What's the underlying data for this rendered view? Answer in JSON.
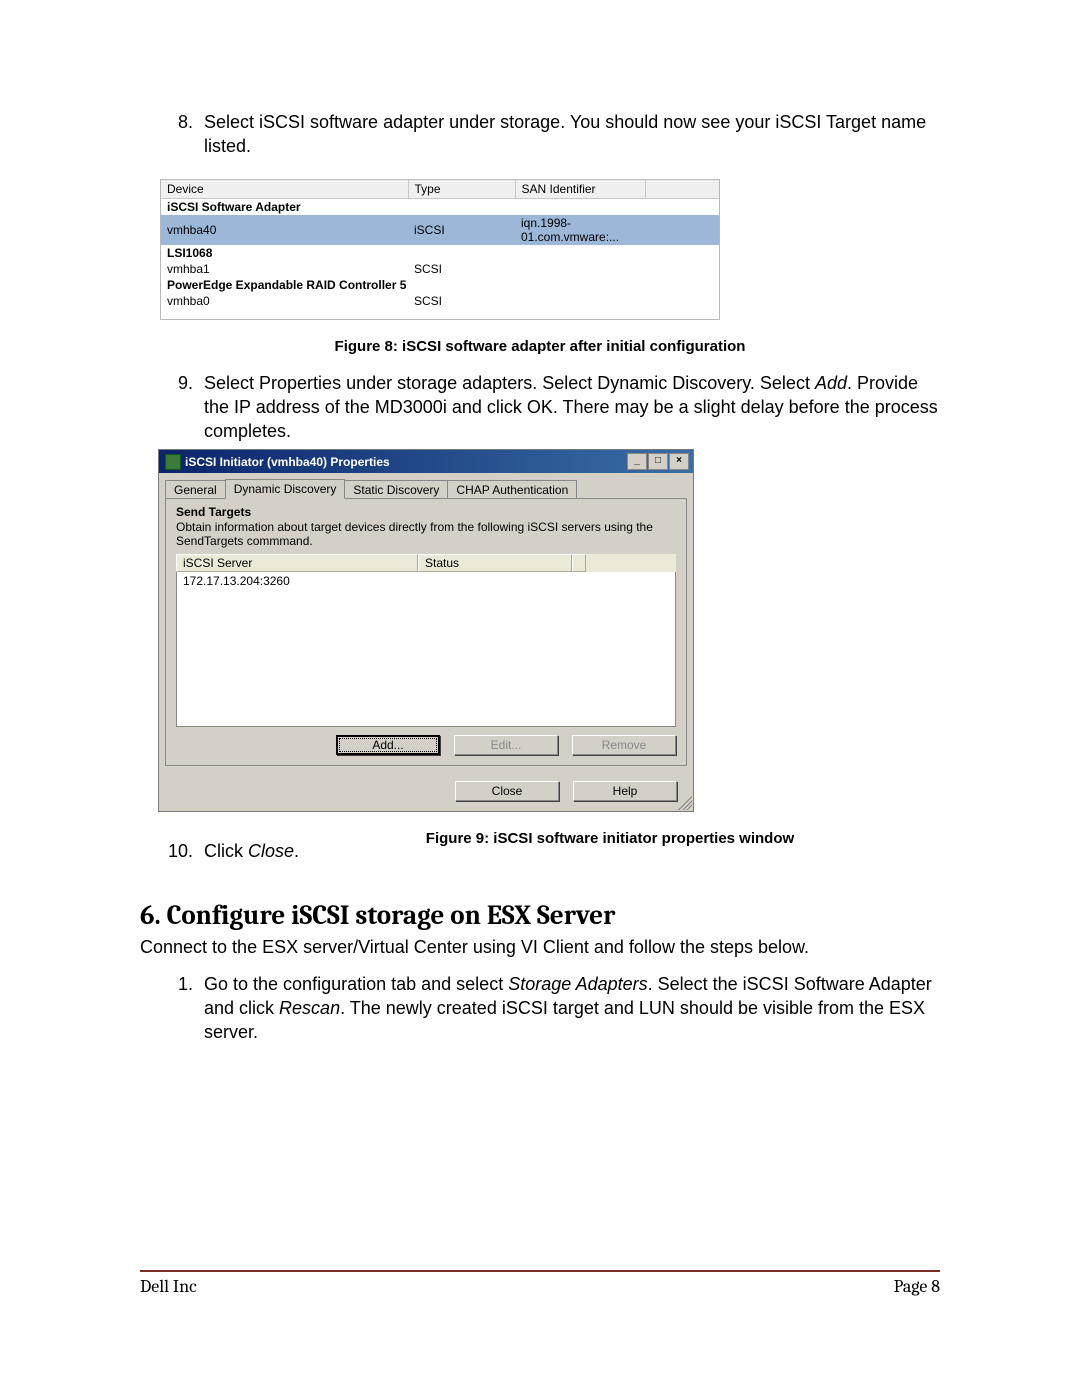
{
  "steps": {
    "step8": "Select iSCSI software adapter under storage. You should now see your iSCSI Target name listed.",
    "step9_a": "Select Properties under storage adapters. Select Dynamic Discovery. Select ",
    "step9_add": "Add",
    "step9_b": ". Provide the IP address of the MD3000i and click OK.  There may be a slight delay before the process completes.",
    "step10_a": "Click ",
    "step10_close": "Close",
    "step10_b": "."
  },
  "figure8": {
    "headers": {
      "device": "Device",
      "type": "Type",
      "san": "SAN Identifier"
    },
    "groups": [
      {
        "name": "iSCSI Software Adapter",
        "rows": [
          {
            "device": "vmhba40",
            "type": "iSCSI",
            "san": "iqn.1998-01.com.vmware:...",
            "selected": true
          }
        ]
      },
      {
        "name": "LSI1068",
        "rows": [
          {
            "device": "vmhba1",
            "type": "SCSI",
            "san": ""
          }
        ]
      },
      {
        "name": "PowerEdge Expandable RAID Controller 5",
        "rows": [
          {
            "device": "vmhba0",
            "type": "SCSI",
            "san": ""
          }
        ]
      }
    ],
    "caption": "Figure 8: iSCSI software adapter after initial configuration"
  },
  "dialog": {
    "title": "iSCSI Initiator (vmhba40) Properties",
    "tabs": [
      "General",
      "Dynamic Discovery",
      "Static Discovery",
      "CHAP Authentication"
    ],
    "active_tab": 1,
    "send_targets_title": "Send Targets",
    "send_targets_desc": "Obtain information about target devices directly from the following iSCSI servers using the SendTargets commmand.",
    "columns": {
      "server": "iSCSI Server",
      "status": "Status"
    },
    "rows": [
      {
        "server": "172.17.13.204:3260",
        "status": ""
      }
    ],
    "buttons": {
      "add": "Add...",
      "edit": "Edit...",
      "remove": "Remove",
      "close": "Close",
      "help": "Help"
    },
    "winbtn": {
      "min": "_",
      "max": "□",
      "close": "×"
    },
    "caption": "Figure 9: iSCSI software initiator properties window"
  },
  "section6": {
    "title": "6. Configure iSCSI storage on ESX Server",
    "intro": "Connect to the ESX server/Virtual Center using VI Client and follow the steps below.",
    "step1_a": "Go to the configuration tab and select ",
    "step1_i1": "Storage Adapters",
    "step1_b": ". Select the iSCSI Software Adapter and click ",
    "step1_i2": "Rescan",
    "step1_c": ". The newly created iSCSI target and LUN should be visible from the ESX server."
  },
  "footer": {
    "left": "Dell Inc",
    "right": "Page 8"
  }
}
